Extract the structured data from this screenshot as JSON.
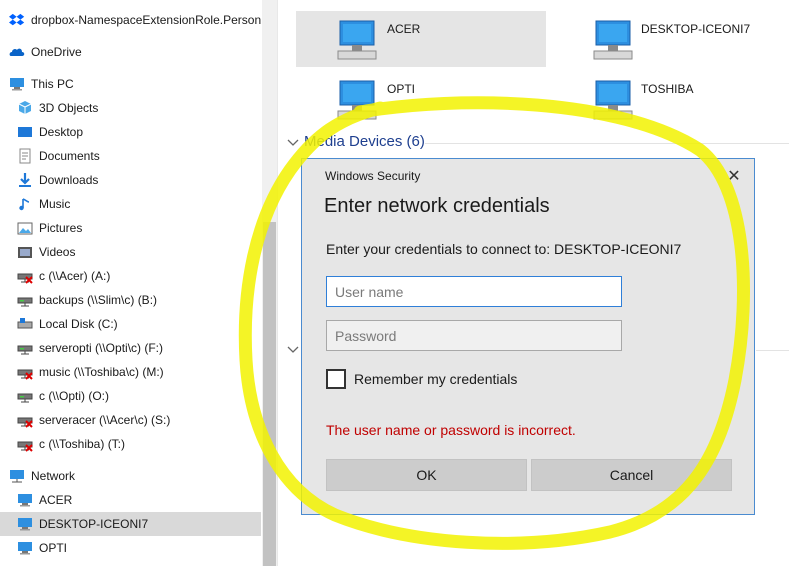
{
  "sidebar": {
    "items": [
      {
        "label": "dropbox-NamespaceExtensionRole.Persona",
        "icon": "dropbox-icon"
      },
      {
        "label": "OneDrive",
        "icon": "onedrive-icon"
      },
      {
        "label": "This PC",
        "icon": "this-pc-icon"
      },
      {
        "label": "3D Objects",
        "icon": "3d-objects-icon"
      },
      {
        "label": "Desktop",
        "icon": "desktop-folder-icon"
      },
      {
        "label": "Documents",
        "icon": "documents-icon"
      },
      {
        "label": "Downloads",
        "icon": "downloads-icon"
      },
      {
        "label": "Music",
        "icon": "music-icon"
      },
      {
        "label": "Pictures",
        "icon": "pictures-icon"
      },
      {
        "label": "Videos",
        "icon": "videos-icon"
      },
      {
        "label": "c (\\\\Acer) (A:)",
        "icon": "disconnected-drive-icon"
      },
      {
        "label": "backups (\\\\Slim\\c) (B:)",
        "icon": "network-drive-icon"
      },
      {
        "label": "Local Disk (C:)",
        "icon": "local-disk-icon"
      },
      {
        "label": "serveropti (\\\\Opti\\c) (F:)",
        "icon": "network-drive-icon"
      },
      {
        "label": "music (\\\\Toshiba\\c) (M:)",
        "icon": "disconnected-drive-icon"
      },
      {
        "label": "c (\\\\Opti) (O:)",
        "icon": "network-drive-icon"
      },
      {
        "label": "serveracer (\\\\Acer\\c) (S:)",
        "icon": "disconnected-drive-icon"
      },
      {
        "label": "c (\\\\Toshiba) (T:)",
        "icon": "disconnected-drive-icon"
      },
      {
        "label": "Network",
        "icon": "network-icon"
      },
      {
        "label": "ACER",
        "icon": "computer-icon"
      },
      {
        "label": "DESKTOP-ICEONI7",
        "icon": "computer-icon",
        "selected": true
      },
      {
        "label": "OPTI",
        "icon": "computer-icon"
      }
    ]
  },
  "main": {
    "computers": [
      {
        "label": "ACER",
        "selected": true
      },
      {
        "label": "DESKTOP-ICEONI7"
      },
      {
        "label": "OPTI"
      },
      {
        "label": "TOSHIBA"
      }
    ],
    "media_group": {
      "label": "Media Devices (6)"
    }
  },
  "dialog": {
    "caption": "Windows Security",
    "close_glyph": "✕",
    "title": "Enter network credentials",
    "message": "Enter your credentials to connect to: DESKTOP-ICEONI7",
    "username_placeholder": "User name",
    "password_placeholder": "Password",
    "remember_label": "Remember my credentials",
    "error": "The user name or password is incorrect.",
    "ok_label": "OK",
    "cancel_label": "Cancel"
  },
  "colors": {
    "accent": "#2f7fd8",
    "error": "#c00000",
    "highlight": "#f2f200",
    "group_header": "#1e3f8f"
  }
}
